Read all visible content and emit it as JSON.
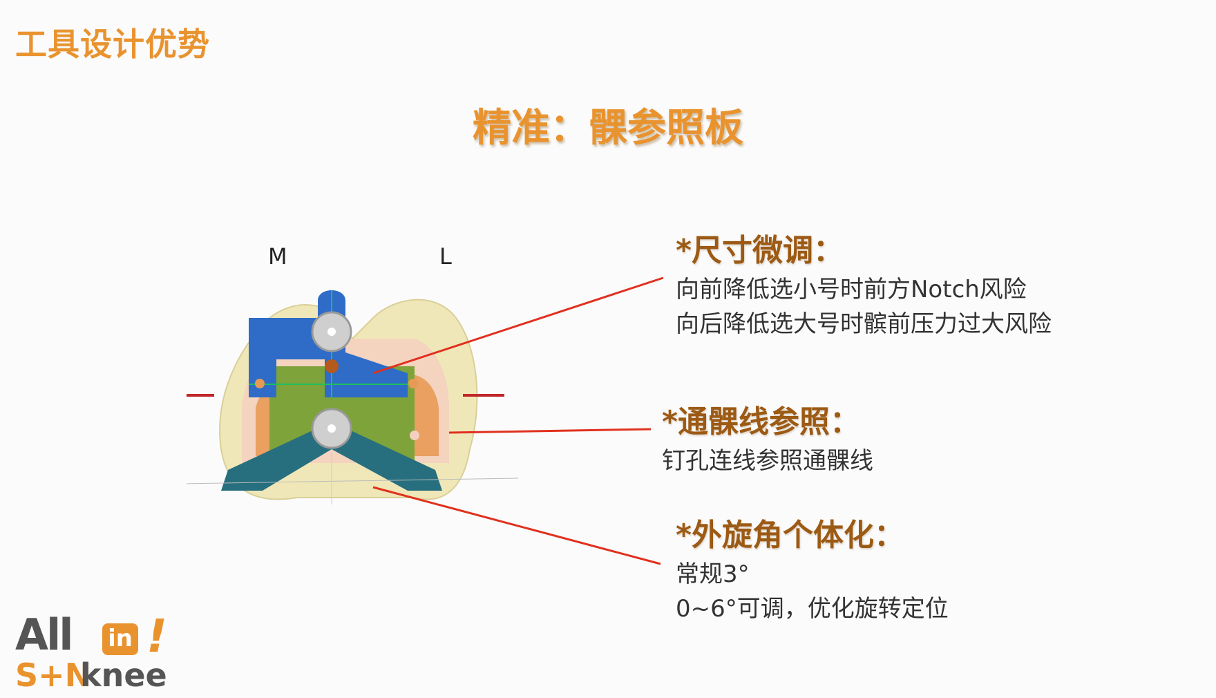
{
  "header": {
    "title": "工具设计优势"
  },
  "slide": {
    "subtitle": "精准：髁参照板"
  },
  "figure": {
    "label_medial": "M",
    "label_lateral": "L"
  },
  "callouts": [
    {
      "heading": "*尺寸微调：",
      "lines": [
        "向前降低选小号时前方Notch风险",
        "向后降低选大号时髌前压力过大风险"
      ]
    },
    {
      "heading": "*通髁线参照：",
      "lines": [
        "钉孔连线参照通髁线"
      ]
    },
    {
      "heading": "*外旋角个体化：",
      "lines": [
        "常规3°",
        "0~6°可调，优化旋转定位"
      ]
    }
  ],
  "logo": {
    "line1_a": "All",
    "line1_in": "in",
    "line1_bang": "!",
    "line2_a": "S+N",
    "line2_b": "knee"
  },
  "colors": {
    "accent": "#e9932f",
    "heading_brown": "#9c5a14",
    "leader_red": "#e0301e"
  }
}
